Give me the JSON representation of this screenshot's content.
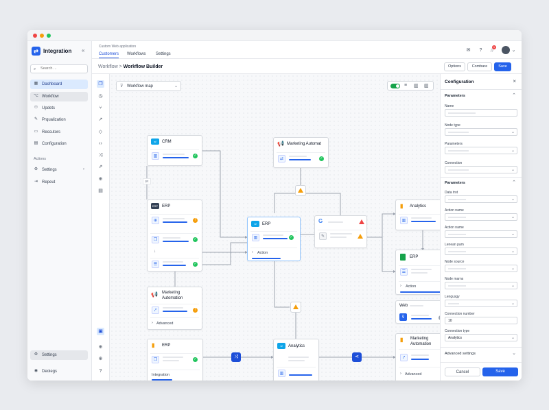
{
  "app": {
    "brand": "Integration",
    "subtitle": "Custom Web application"
  },
  "sidebar": {
    "search_placeholder": "Search ...",
    "items": [
      {
        "label": "Dashboard",
        "icon": "dashboard-icon",
        "active": true
      },
      {
        "label": "Workflow",
        "icon": "workflow-icon"
      },
      {
        "label": "Updets",
        "icon": "users-icon"
      },
      {
        "label": "Prqualization",
        "icon": "pencil-icon"
      },
      {
        "label": "Reccutors",
        "icon": "folder-icon"
      },
      {
        "label": "Configuration",
        "icon": "grid-icon"
      }
    ],
    "actions_label": "Actions",
    "actions": [
      {
        "label": "Settings",
        "icon": "gear-icon"
      },
      {
        "label": "Repeut",
        "icon": "export-icon"
      }
    ],
    "footer_settings": "Settings",
    "footer_user": "Deoiegs"
  },
  "topbar": {
    "tabs": [
      "Customers",
      "Workflows",
      "Settings"
    ],
    "notification_count": "1"
  },
  "breadcrumb": {
    "parent": "Workflow",
    "sep": ">",
    "current": "Workflow Builder"
  },
  "toolbar": {
    "options": "Options",
    "combare": "Combare",
    "save": "Save"
  },
  "canvas": {
    "map_select": "Workflow map",
    "nodes": {
      "crm": "CRM",
      "marketing_top": "Marketing Automat",
      "erp_left": "ERP",
      "erp_center": "ERP",
      "analytics_right": "Analytics",
      "erp_right": "ERP",
      "marketing_left": "Marketing Automation",
      "web": "Web",
      "erp_bottom": "ERP",
      "analytics_center": "Analytics",
      "marketing_right": "Marketing Automation",
      "jr": "JR",
      "action": "Action",
      "advanced": "Advanced",
      "integration": "Integration"
    }
  },
  "panel": {
    "title": "Configuration",
    "section1": "Parameters",
    "name_label": "Name",
    "node_type_label": "Node type",
    "parameters_label": "Parameters",
    "connection_label": "Connection",
    "section2": "Parameters",
    "fields": [
      "Data trot",
      "Action name",
      "Action name",
      "Lenean pam",
      "Node source",
      "Node marns",
      "Lengusgy"
    ],
    "connection_number_label": "Connection number",
    "connection_number_value": "10",
    "connection_type_label": "Connection type",
    "connection_type_value": "Analytics",
    "advanced_settings": "Advanced settings",
    "cancel": "Cancel",
    "save": "Save"
  }
}
